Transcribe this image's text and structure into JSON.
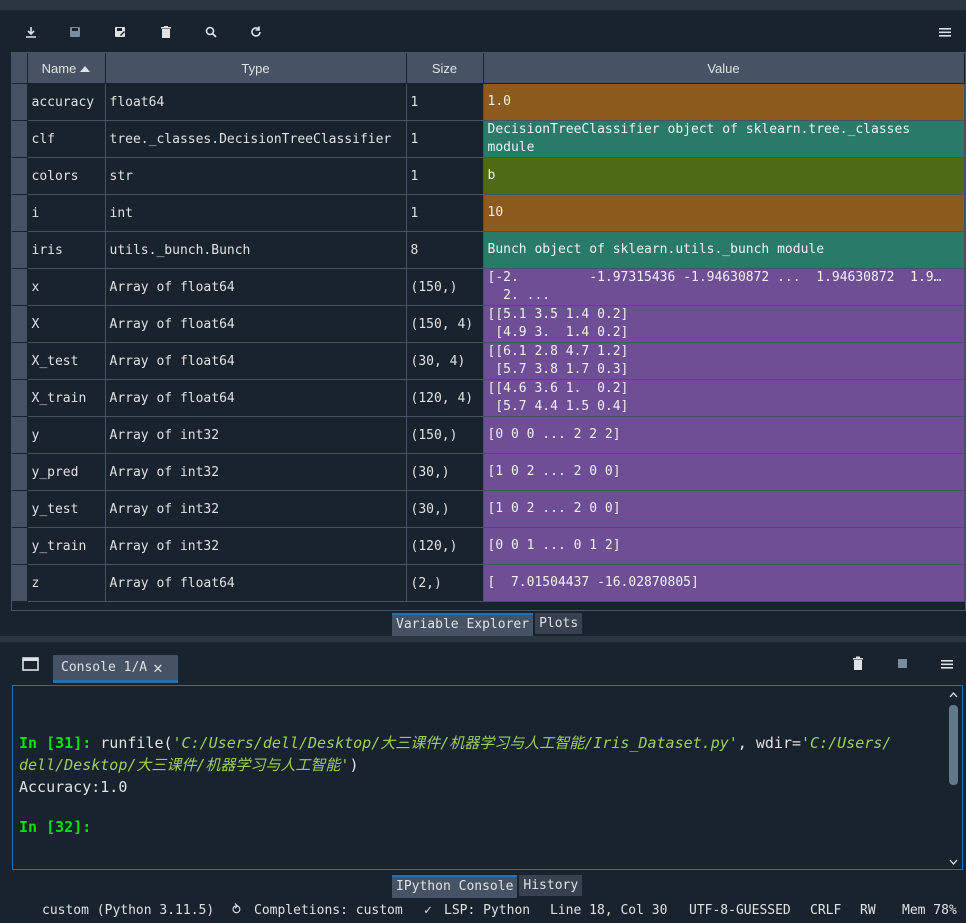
{
  "toolbar": {
    "icons": [
      "import-data-icon",
      "save-data-icon",
      "save-as-icon",
      "delete-icon",
      "search-icon",
      "refresh-icon",
      "menu-icon"
    ]
  },
  "variable_table": {
    "headers": {
      "name": "Name",
      "type": "Type",
      "size": "Size",
      "value": "Value"
    },
    "rows": [
      {
        "name": "accuracy",
        "type": "float64",
        "size": "1",
        "value": "1.0",
        "color": "#8c5a1c"
      },
      {
        "name": "clf",
        "type": "tree._classes.DecisionTreeClassifier",
        "size": "1",
        "value": "DecisionTreeClassifier object of sklearn.tree._classes\nmodule",
        "color": "#2a7a69"
      },
      {
        "name": "colors",
        "type": "str",
        "size": "1",
        "value": "b",
        "color": "#4e6a17"
      },
      {
        "name": "i",
        "type": "int",
        "size": "1",
        "value": "10",
        "color": "#8c5a1c"
      },
      {
        "name": "iris",
        "type": "utils._bunch.Bunch",
        "size": "8",
        "value": "Bunch object of sklearn.utils._bunch module",
        "color": "#2a7a69"
      },
      {
        "name": "x",
        "type": "Array of float64",
        "size": "(150,)",
        "value": "[-2.         -1.97315436 -1.94630872 ...  1.94630872  1.9…\n  2. ...",
        "color": "#6e4f96"
      },
      {
        "name": "X",
        "type": "Array of float64",
        "size": "(150, 4)",
        "value": "[[5.1 3.5 1.4 0.2]\n [4.9 3.  1.4 0.2]",
        "color": "#6e4f96"
      },
      {
        "name": "X_test",
        "type": "Array of float64",
        "size": "(30, 4)",
        "value": "[[6.1 2.8 4.7 1.2]\n [5.7 3.8 1.7 0.3]",
        "color": "#6e4f96"
      },
      {
        "name": "X_train",
        "type": "Array of float64",
        "size": "(120, 4)",
        "value": "[[4.6 3.6 1.  0.2]\n [5.7 4.4 1.5 0.4]",
        "color": "#6e4f96"
      },
      {
        "name": "y",
        "type": "Array of int32",
        "size": "(150,)",
        "value": "[0 0 0 ... 2 2 2]",
        "color": "#6e4f96"
      },
      {
        "name": "y_pred",
        "type": "Array of int32",
        "size": "(30,)",
        "value": "[1 0 2 ... 2 0 0]",
        "color": "#6e4f96"
      },
      {
        "name": "y_test",
        "type": "Array of int32",
        "size": "(30,)",
        "value": "[1 0 2 ... 2 0 0]",
        "color": "#6e4f96"
      },
      {
        "name": "y_train",
        "type": "Array of int32",
        "size": "(120,)",
        "value": "[0 0 1 ... 0 1 2]",
        "color": "#6e4f96"
      },
      {
        "name": "z",
        "type": "Array of float64",
        "size": "(2,)",
        "value": "[  7.01504437 -16.02870805]",
        "color": "#6e4f96"
      }
    ]
  },
  "top_tabs": [
    "Variable Explorer",
    "Plots"
  ],
  "console": {
    "tab_label": "Console 1/A",
    "line1_prompt_pre": "In [",
    "line1_num": "31",
    "line1_prompt_post": "]: ",
    "line1_code_pre": "runfile(",
    "line1_str1": "'C:/Users/dell/Desktop/大三课件/机器学习与人工智能/Iris_Dataset.py'",
    "line1_code_mid": ", wdir=",
    "line1_str2a": "'C:/Users/",
    "line2_str2b": "dell/Desktop/大三课件/机器学习与人工智能'",
    "line2_code_end": ")",
    "output": "Accuracy:1.0",
    "line3_prompt_pre": "In [",
    "line3_num": "32",
    "line3_prompt_post": "]: "
  },
  "bottom_tabs": [
    "IPython Console",
    "History"
  ],
  "status_bar": {
    "env": "custom (Python 3.11.5)",
    "completions": "Completions: custom",
    "lsp": "LSP: Python",
    "position": "Line 18, Col 30",
    "encoding": "UTF-8-GUESSED",
    "eol": "CRLF",
    "perm": "RW",
    "mem": "Mem 78%"
  },
  "colors": {
    "background": "#19232d",
    "accent": "#1a72bb",
    "header": "#455364"
  }
}
